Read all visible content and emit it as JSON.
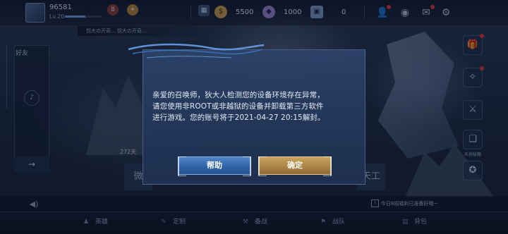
{
  "topbar": {
    "player_id": "96581",
    "level": "Lv.20",
    "exp_fraction": 0.55,
    "mini_icons": [
      {
        "name": "mail-badge-icon",
        "glyph": "8",
        "label": "",
        "color": "#8a3a3a"
      },
      {
        "name": "honor-icon",
        "glyph": "✦",
        "label": "",
        "color": "#b8863a"
      }
    ],
    "currency": [
      {
        "name": "gold-coin-icon",
        "glyph": "$",
        "value": "5500",
        "color": "#c8a050"
      },
      {
        "name": "gem-icon",
        "glyph": "◆",
        "value": "1000",
        "color": "#9a86d8"
      },
      {
        "name": "coupon-icon",
        "glyph": "▣",
        "value": "0",
        "color": "#7f9cc8"
      }
    ],
    "right_icons": [
      {
        "name": "friends-icon",
        "glyph": "👤"
      },
      {
        "name": "eye-icon",
        "glyph": "◉"
      },
      {
        "name": "mail-icon",
        "glyph": "✉"
      },
      {
        "name": "settings-icon",
        "glyph": "⚙"
      }
    ]
  },
  "marquee": {
    "text": "恺大の开奇... 恺大の开奇..."
  },
  "left_panel": {
    "friends_tab": "好友",
    "expand_arrow": "→"
  },
  "scene_count": "272天",
  "right_buttons": [
    {
      "name": "gift-icon",
      "glyph": "🎁",
      "label": ""
    },
    {
      "name": "event-icon",
      "glyph": "✧",
      "label": ""
    },
    {
      "name": "sword-icon",
      "glyph": "⚔",
      "label": ""
    },
    {
      "name": "book-icon",
      "glyph": "❏",
      "label": ""
    },
    {
      "name": "ranked-icon",
      "glyph": "✪",
      "label": "天地秘籍"
    }
  ],
  "bg_buttons": {
    "left": "微",
    "right": "天工"
  },
  "bottom": {
    "voice_glyph": "◀)",
    "hint_text": "今日8招福利已准备好哦~",
    "hint_glyph": "!"
  },
  "nav": [
    {
      "name": "nav-heroes",
      "glyph": "♟",
      "label": "英雄"
    },
    {
      "name": "nav-custom",
      "glyph": "✎",
      "label": "定制"
    },
    {
      "name": "nav-prepare",
      "glyph": "⚒",
      "label": "备战"
    },
    {
      "name": "nav-team",
      "glyph": "⚑",
      "label": "战队"
    },
    {
      "name": "nav-bag",
      "glyph": "▤",
      "label": "背包"
    }
  ],
  "dialog": {
    "message_lines": [
      "亲爱的召唤师，狄大人检测您的设备环境存在异常，",
      "请您使用非ROOT或非越狱的设备并卸载第三方软件",
      "进行游戏。您的账号将于2021-04-27 20:15解封。"
    ],
    "help_label": "帮助",
    "confirm_label": "确定"
  }
}
